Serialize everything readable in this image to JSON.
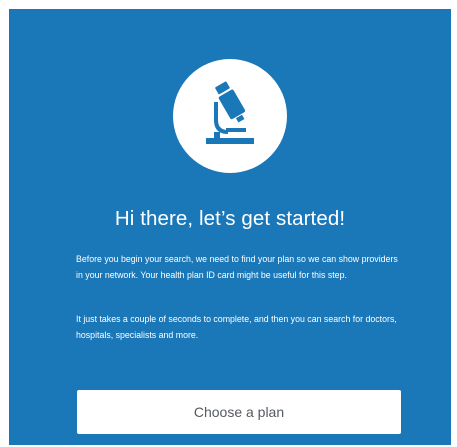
{
  "onboarding": {
    "icon": "microscope-icon",
    "title": "Hi there, let’s get started!",
    "paragraph_1": "Before you begin your search, we need to find your plan so we can show providers in your network. Your health plan ID card might be useful for this step.",
    "paragraph_2": "It just takes a couple of seconds to complete, and then you can search for doctors, hospitals, specialists and more.",
    "cta_label": "Choose a plan"
  },
  "colors": {
    "background": "#1a77b8",
    "icon": "#1a77b8",
    "button_bg": "#ffffff",
    "button_text": "#555a60"
  }
}
